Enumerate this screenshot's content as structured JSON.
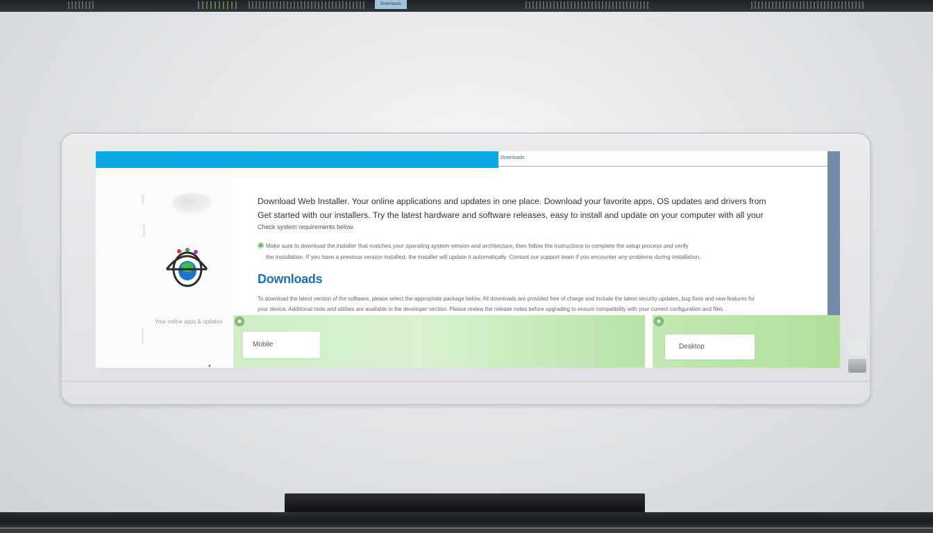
{
  "top_strip": {
    "tab_label": "Downloads"
  },
  "browser": {
    "url": "Downloads"
  },
  "sidebar": {
    "caption": "Your online apps & updates",
    "caret": "▾"
  },
  "main": {
    "intro_line1": "Download Web Installer. Your online applications and updates in one place. Download your favorite apps, OS updates and drivers from",
    "intro_line2": "Get started with our installers. Try the latest hardware and software releases, easy to install and update on your computer with all your",
    "intro_small": "Check system requirements below.",
    "bullet_line1": "Make sure to download the installer that matches your operating system version and architecture, then follow the instructions to complete the setup process and verify",
    "bullet_line2": "the installation. If you have a previous version installed, the installer will update it automatically. Contact our support team if you encounter any problems during installation.",
    "heading": "Downloads",
    "body_line1": "To download the latest version of the software, please select the appropriate package below. All downloads are provided free of charge and include the latest security updates, bug fixes and new features for",
    "body_line2": "your device. Additional tools and utilities are available in the developer section. Please review the release notes before upgrading to ensure compatibility with your current configuration and files."
  },
  "panels": {
    "left_field": "Mobile",
    "right_field": "Desktop"
  },
  "colors": {
    "accent_blue": "#0aa8e6",
    "heading_blue": "#1c6fc1",
    "panel_green": "#cfedc6",
    "scroll_rail": "#7589a8"
  }
}
